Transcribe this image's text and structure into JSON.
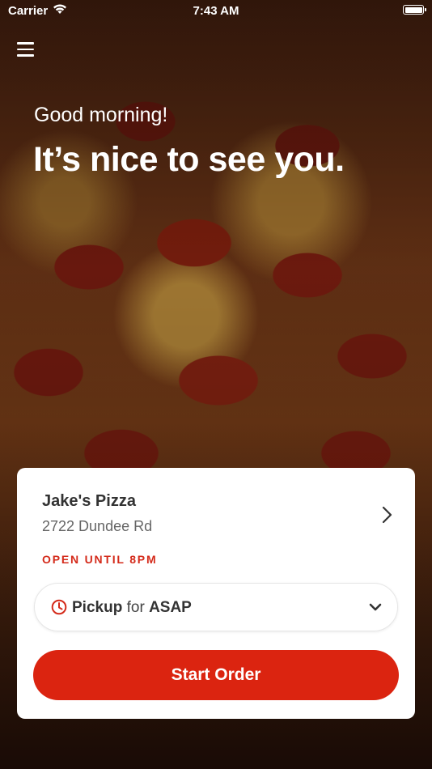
{
  "status_bar": {
    "carrier": "Carrier",
    "time": "7:43 AM",
    "wifi_icon": "wifi-icon",
    "battery_icon": "battery-icon"
  },
  "header": {
    "menu_icon": "hamburger-menu-icon",
    "greeting": "Good morning!",
    "headline": "It’s nice to see you."
  },
  "store_card": {
    "name": "Jake's Pizza",
    "address": "2722 Dundee Rd",
    "open_status": "OPEN UNTIL 8PM",
    "status_color": "#d42a1a",
    "order_type": {
      "method": "Pickup",
      "connector": "for",
      "time": "ASAP",
      "icon": "clock-icon"
    },
    "start_button": "Start Order",
    "button_color": "#db2410"
  }
}
